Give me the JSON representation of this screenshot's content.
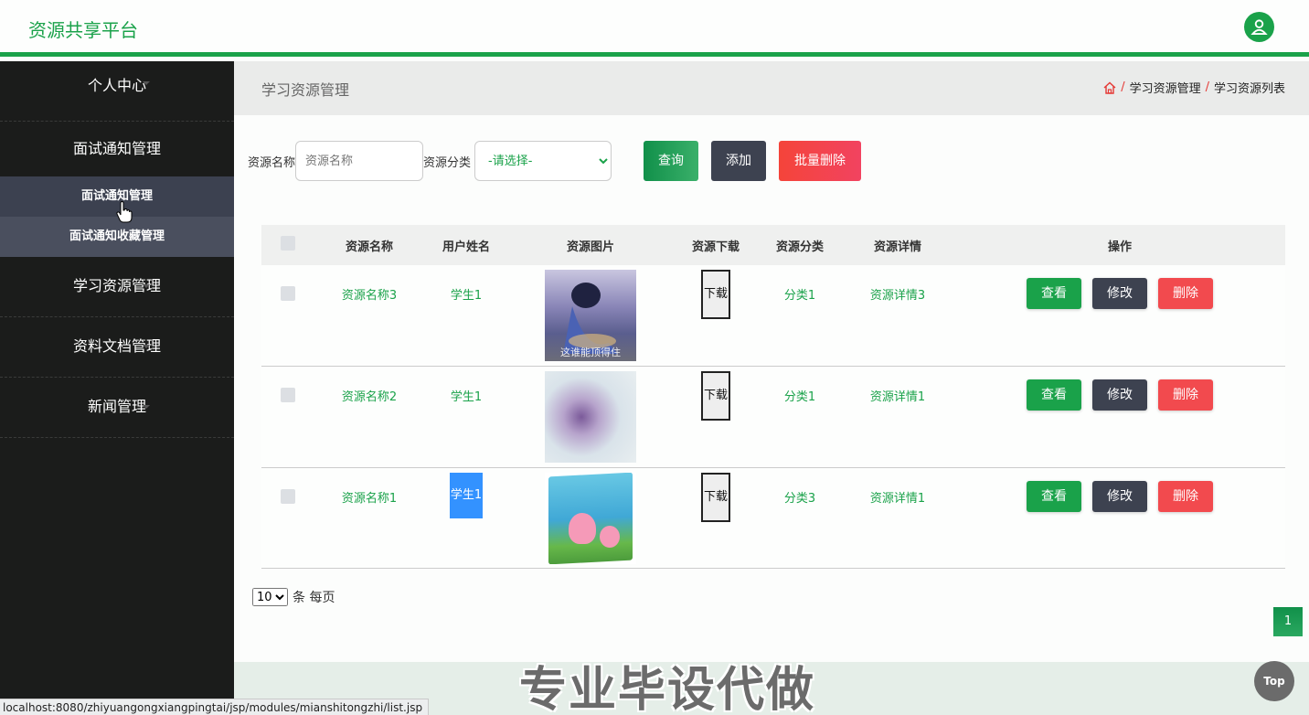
{
  "header": {
    "brand": "资源共享平台",
    "user_icon": "user-icon"
  },
  "sidebar": {
    "items": [
      {
        "label": "个人中心"
      },
      {
        "label": "面试通知管理",
        "children": [
          {
            "label": "面试通知管理"
          },
          {
            "label": "面试通知收藏管理"
          }
        ]
      },
      {
        "label": "学习资源管理"
      },
      {
        "label": "资料文档管理"
      },
      {
        "label": "新闻管理"
      }
    ]
  },
  "page": {
    "title": "学习资源管理",
    "breadcrumb": {
      "home_icon": "home-icon",
      "sep": "/",
      "level1": "学习资源管理",
      "level2": "学习资源列表"
    }
  },
  "search": {
    "name_label": "资源名称",
    "name_placeholder": "资源名称",
    "category_label": "资源分类",
    "category_selected": "-请选择-",
    "query_button": "查询",
    "add_button": "添加",
    "bulk_delete_button": "批量删除"
  },
  "table": {
    "columns": [
      "资源名称",
      "用户姓名",
      "资源图片",
      "资源下载",
      "资源分类",
      "资源详情",
      "操作"
    ],
    "rows": [
      {
        "name": "资源名称3",
        "user": "学生1",
        "image_caption": "这谁能顶得住",
        "download": "下载",
        "category": "分类1",
        "detail": "资源详情3"
      },
      {
        "name": "资源名称2",
        "user": "学生1",
        "image_caption": "",
        "download": "下载",
        "category": "分类1",
        "detail": "资源详情1"
      },
      {
        "name": "资源名称1",
        "user": "学生1",
        "image_caption": "",
        "download": "下载",
        "category": "分类3",
        "detail": "资源详情1"
      }
    ],
    "actions": {
      "view": "查看",
      "edit": "修改",
      "delete": "删除"
    }
  },
  "pager": {
    "page_size": "10",
    "suffix": "条 每页",
    "current_page": "1"
  },
  "watermark": "专业毕设代做",
  "top_button": "Top",
  "status_url": "localhost:8080/zhiyuangongxiangpingtai/jsp/modules/mianshitongzhi/list.jsp",
  "colors": {
    "accent": "#1aa24a",
    "danger": "#f24a4e",
    "dark": "#3d4250"
  }
}
